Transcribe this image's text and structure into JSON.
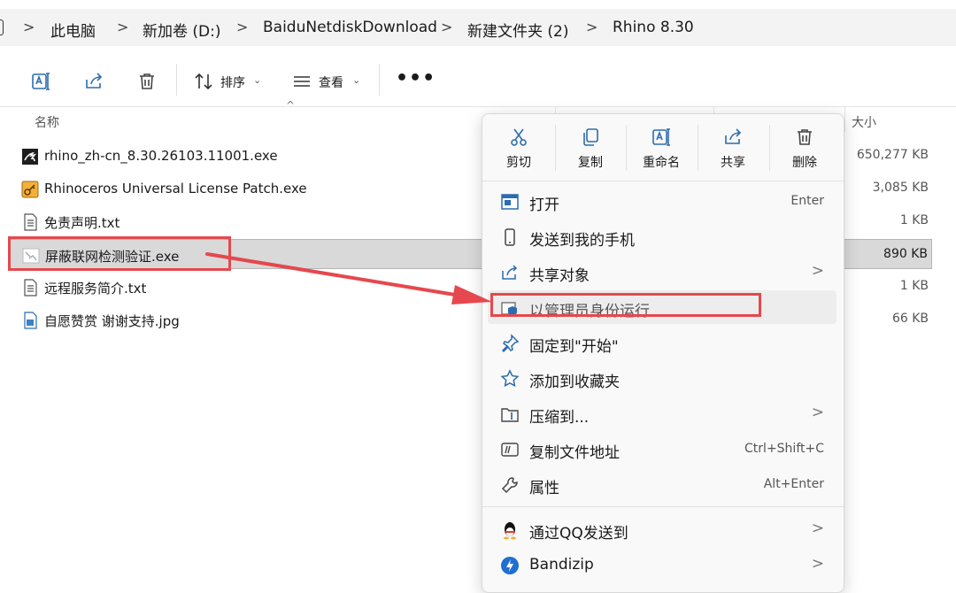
{
  "breadcrumb": {
    "items": [
      "此电脑",
      "新加卷 (D:)",
      "BaiduNetdiskDownload",
      "新建文件夹 (2)",
      "Rhino 8.30"
    ],
    "separator": ">"
  },
  "toolbar": {
    "sort_label": "排序",
    "view_label": "查看",
    "more_label": "•••",
    "icons": [
      "rename-icon",
      "share-icon",
      "delete-icon",
      "sort-icon",
      "view-icon",
      "more-icon"
    ]
  },
  "columns": {
    "name": "名称",
    "size": "大小",
    "sort_indicator": "^"
  },
  "files": [
    {
      "name": "rhino_zh-cn_8.30.26103.11001.exe",
      "size": "650,277 KB",
      "icon": "rhino-exe-icon",
      "selected": false
    },
    {
      "name": "Rhinoceros Universal License Patch.exe",
      "size": "3,085 KB",
      "icon": "patch-exe-icon",
      "selected": false
    },
    {
      "name": "免责声明.txt",
      "size": "1 KB",
      "icon": "text-file-icon",
      "selected": false
    },
    {
      "name": "屏蔽联网检测验证.exe",
      "size": "890 KB",
      "icon": "exe-file-icon",
      "selected": true
    },
    {
      "name": "远程服务简介.txt",
      "size": "1 KB",
      "icon": "text-file-icon",
      "selected": false
    },
    {
      "name": "自愿赞赏 谢谢支持.jpg",
      "size": "66 KB",
      "icon": "image-file-icon",
      "selected": false
    }
  ],
  "context_menu": {
    "quick_actions": [
      {
        "label": "剪切",
        "icon": "cut-icon"
      },
      {
        "label": "复制",
        "icon": "copy-icon"
      },
      {
        "label": "重命名",
        "icon": "rename-icon"
      },
      {
        "label": "共享",
        "icon": "share-icon"
      },
      {
        "label": "删除",
        "icon": "delete-icon"
      }
    ],
    "items": [
      {
        "label": "打开",
        "shortcut": "Enter",
        "icon": "open-icon"
      },
      {
        "label": "发送到我的手机",
        "shortcut": "",
        "icon": "phone-icon"
      },
      {
        "label": "共享对象",
        "shortcut": "",
        "icon": "share-icon",
        "submenu": ">"
      },
      {
        "label": "以管理员身份运行",
        "shortcut": "",
        "icon": "admin-shield-icon",
        "hover": true
      },
      {
        "label": "固定到\"开始\"",
        "shortcut": "",
        "icon": "pin-icon"
      },
      {
        "label": "添加到收藏夹",
        "shortcut": "",
        "icon": "star-icon"
      },
      {
        "label": "压缩到...",
        "shortcut": "",
        "icon": "zip-folder-icon",
        "submenu": ">"
      },
      {
        "label": "复制文件地址",
        "shortcut": "Ctrl+Shift+C",
        "icon": "copy-path-icon"
      },
      {
        "label": "属性",
        "shortcut": "Alt+Enter",
        "icon": "wrench-icon"
      },
      {
        "label": "通过QQ发送到",
        "shortcut": "",
        "icon": "qq-icon",
        "submenu": ">"
      },
      {
        "label": "Bandizip",
        "shortcut": "",
        "icon": "bandizip-icon",
        "submenu": ">"
      }
    ]
  },
  "colors": {
    "accent": "#2b6cb0",
    "annotation": "#e5484d",
    "selection": "#d9d9d9",
    "menu_bg": "#f9f9f9"
  }
}
